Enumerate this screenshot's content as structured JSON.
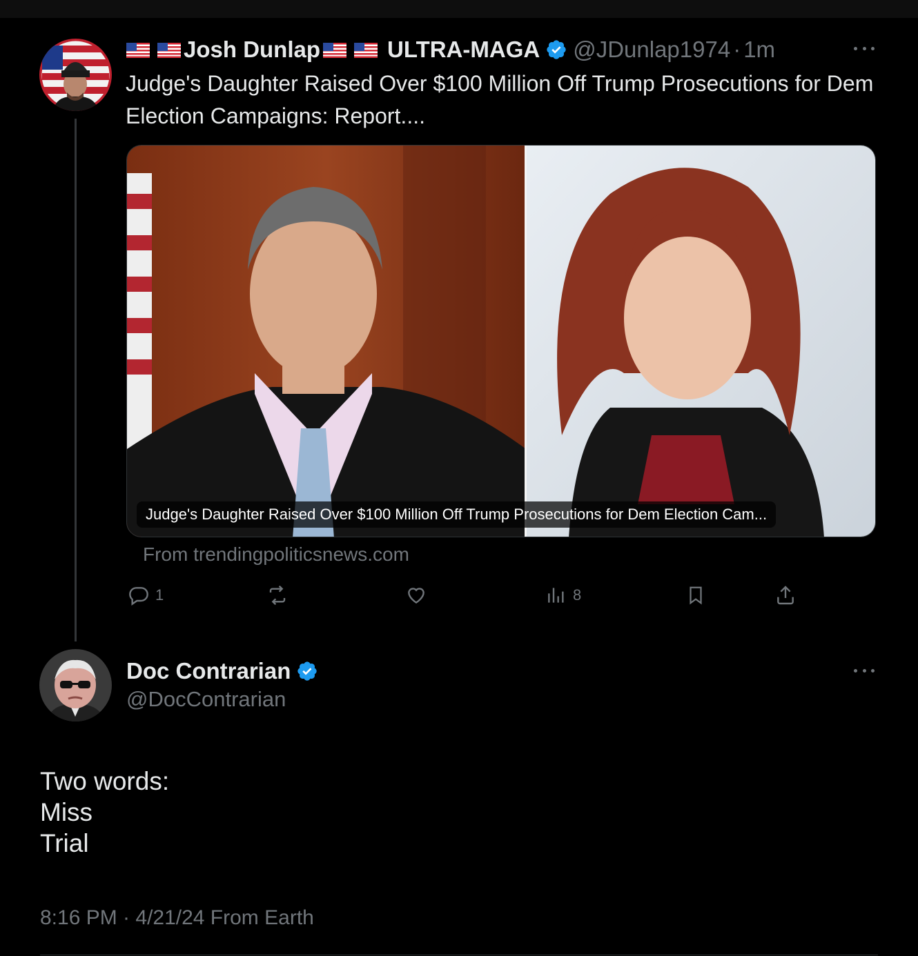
{
  "colors": {
    "background": "#000000",
    "text": "#e7e9ea",
    "muted": "#71767b",
    "verified": "#1d9bf0"
  },
  "original_post": {
    "author": {
      "name_prefix_flags": 2,
      "name": "Josh Dunlap",
      "name_middle_flags": 2,
      "name_suffix": "ULTRA-MAGA",
      "handle": "@JDunlap1974",
      "separator": "·",
      "time": "1m",
      "verified": true,
      "avatar_icon": "avatar-maga-hat-icon"
    },
    "text": "Judge's Daughter Raised Over $100 Million Off Trump Prosecutions for Dem Election Campaigns: Report....",
    "link_card": {
      "caption": "Judge's Daughter Raised Over $100 Million Off Trump Prosecutions for Dem Election Cam...",
      "source": "From trendingpoliticsnews.com"
    },
    "actions": {
      "reply": {
        "icon": "reply-icon",
        "count": "1"
      },
      "repost": {
        "icon": "repost-icon",
        "count": ""
      },
      "like": {
        "icon": "heart-icon",
        "count": ""
      },
      "views": {
        "icon": "views-icon",
        "count": "8"
      },
      "bookmark": {
        "icon": "bookmark-icon"
      },
      "share": {
        "icon": "share-icon"
      }
    }
  },
  "reply_post": {
    "author": {
      "name": "Doc Contrarian",
      "handle": "@DocContrarian",
      "verified": true,
      "avatar_icon": "avatar-old-man-icon"
    },
    "lines": [
      "Two words:",
      "Miss",
      "Trial"
    ],
    "meta": "8:16 PM · 4/21/24 From Earth"
  }
}
